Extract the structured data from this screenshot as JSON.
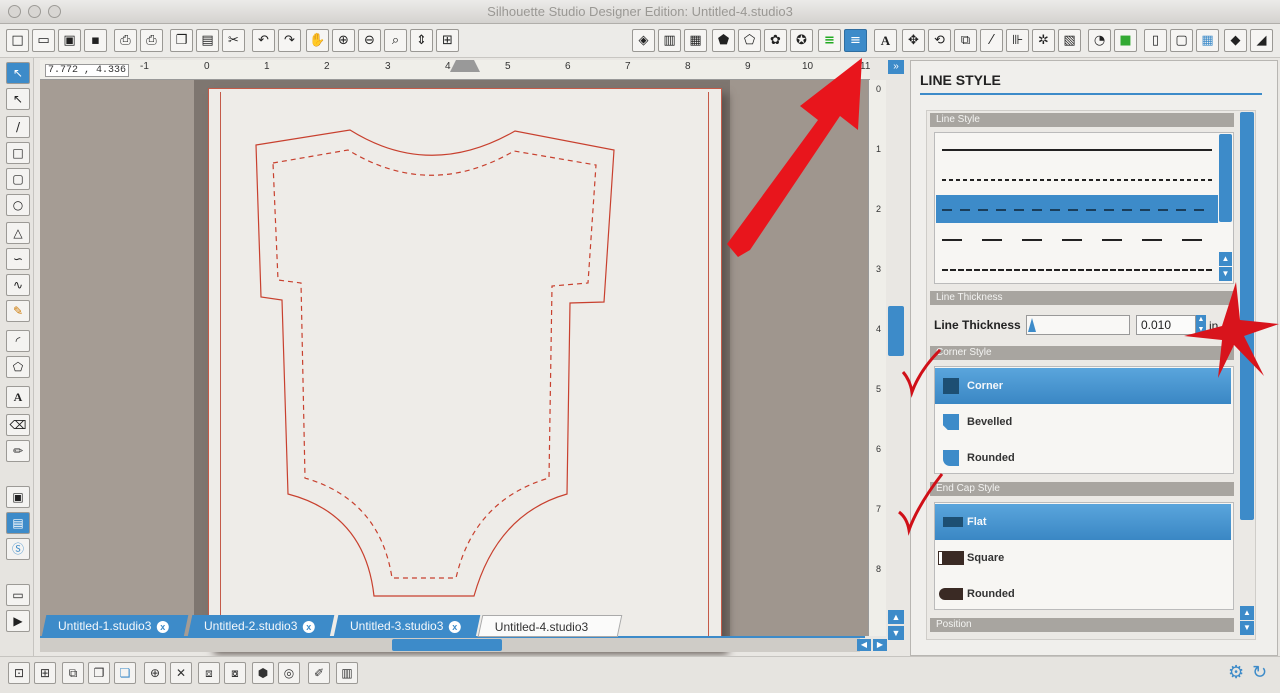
{
  "window": {
    "title": "Silhouette Studio Designer Edition: Untitled-4.studio3"
  },
  "toolbar": {
    "icons": [
      "new-icon",
      "open-icon",
      "save-icon",
      "save-sd-icon",
      "print-icon",
      "print-cut-icon",
      "copy-icon",
      "paste-icon",
      "cut-icon",
      "undo-icon",
      "redo-icon",
      "pan-icon",
      "zoom-in-icon",
      "zoom-out-icon",
      "zoom-select-icon",
      "zoom-drag-icon",
      "zoom-fit-icon",
      "fill-icon",
      "gradient-icon",
      "pattern-icon",
      "line-color-icon",
      "shape-icon",
      "star-icon",
      "polygon-icon",
      "line-color-bars-icon",
      "line-style-icon",
      "text-style-icon",
      "replicate-icon",
      "rotate-icon",
      "scale-icon",
      "move-icon",
      "align-icon",
      "modify-icon",
      "offset-icon",
      "page-settings-icon",
      "cut-settings-icon",
      "send-icon",
      "design-store-icon",
      "layers-icon",
      "library-icon",
      "trace-icon"
    ]
  },
  "ruler": {
    "coord": "7.772 , 4.336",
    "hticks": [
      "-1",
      "0",
      "1",
      "2",
      "3",
      "4",
      "5",
      "6",
      "7",
      "8",
      "9",
      "10",
      "11"
    ],
    "vticks": [
      "0",
      "1",
      "2",
      "3",
      "4",
      "5",
      "6",
      "7",
      "8"
    ]
  },
  "panel": {
    "title": "LINE STYLE",
    "line_style_header": "Line Style",
    "line_thickness_header": "Line Thickness",
    "line_thickness_label": "Line Thickness",
    "line_thickness_value": "0.010",
    "line_thickness_unit": "in",
    "corner_style_header": "Corner Style",
    "corner_options": [
      "Corner",
      "Bevelled",
      "Rounded"
    ],
    "corner_selected": "Corner",
    "endcap_header": "End Cap Style",
    "endcap_options": [
      "Flat",
      "Square",
      "Rounded"
    ],
    "endcap_selected": "Flat",
    "position_header": "Position"
  },
  "tabs": [
    {
      "label": "Untitled-1.studio3",
      "active": false
    },
    {
      "label": "Untitled-2.studio3",
      "active": false
    },
    {
      "label": "Untitled-3.studio3",
      "active": false
    },
    {
      "label": "Untitled-4.studio3",
      "active": true
    }
  ],
  "colors": {
    "accent": "#3d8bc9",
    "arrow": "#e8151c",
    "cut_line": "#c8402e"
  }
}
